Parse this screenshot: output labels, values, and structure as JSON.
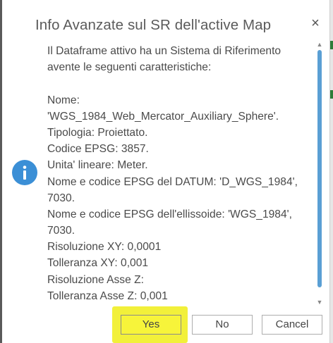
{
  "dialog": {
    "title": "Info Avanzate sul SR dell'active Map",
    "close_symbol": "×",
    "icon": "info-icon",
    "message_lines": [
      "Il Dataframe attivo ha un Sistema di Riferimento",
      "avente le seguenti caratteristiche:",
      "",
      "Nome:",
      "'WGS_1984_Web_Mercator_Auxiliary_Sphere'.",
      "Tipologia: Proiettato.",
      "Codice EPSG: 3857.",
      "Unita' lineare: Meter.",
      "Nome e codice EPSG del DATUM: 'D_WGS_1984',",
      "7030.",
      "Nome e codice EPSG dell'ellissoide: 'WGS_1984',",
      "7030.",
      "Risoluzione XY: 0,0001",
      "Tolleranza XY: 0,001",
      "Risoluzione Asse Z:",
      "Tolleranza Asse Z: 0,001"
    ],
    "buttons": {
      "yes": "Yes",
      "no": "No",
      "cancel": "Cancel"
    },
    "scroll_up_symbol": "▲",
    "scroll_down_symbol": "▼"
  },
  "colors": {
    "accent": "#3b8fd6",
    "highlight": "#f2f03a",
    "scrollbar_thumb": "#5a9fd4"
  }
}
